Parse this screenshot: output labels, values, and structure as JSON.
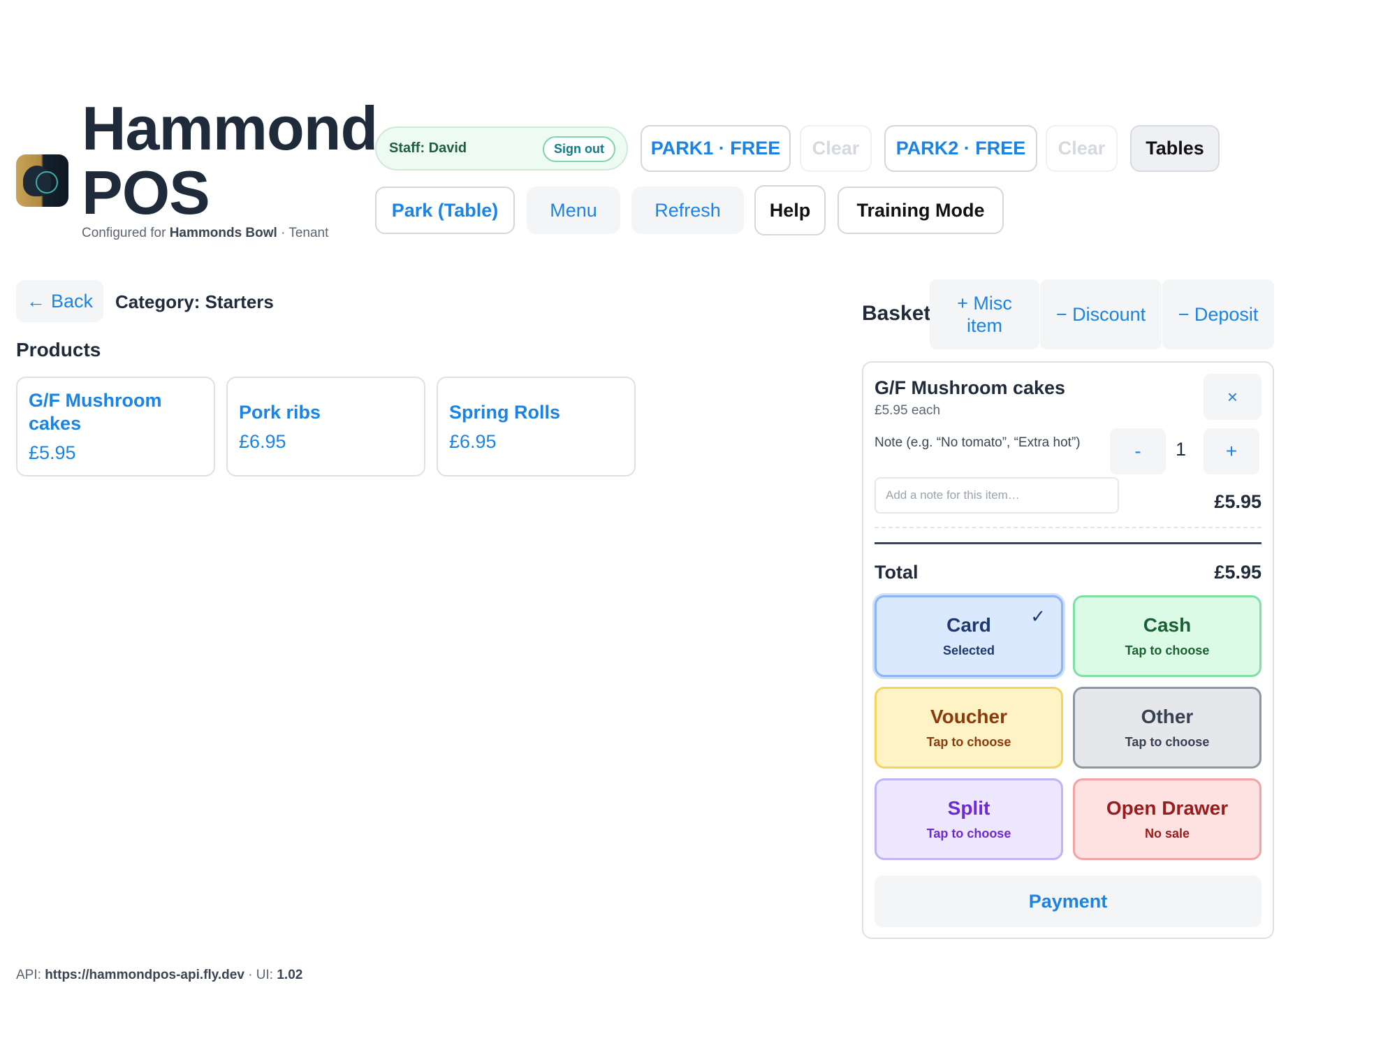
{
  "brand": {
    "title": "Hammond POS",
    "config_prefix": "Configured for",
    "tenant_name": "Hammonds Bowl",
    "config_suffix": "· Tenant"
  },
  "header": {
    "staff_label": "Staff: David",
    "sign_out": "Sign out",
    "park1": "PARK1 · FREE",
    "park1_clear": "Clear",
    "park2": "PARK2 · FREE",
    "park2_clear": "Clear",
    "tables": "Tables",
    "park_table": "Park (Table)",
    "menu": "Menu",
    "refresh": "Refresh",
    "help": "Help",
    "training": "Training Mode"
  },
  "category": {
    "back_arrow": "←",
    "back": "Back",
    "title": "Category: Starters",
    "products_heading": "Products"
  },
  "products": [
    {
      "name": "G/F Mushroom cakes",
      "price": "£5.95"
    },
    {
      "name": "Pork ribs",
      "price": "£6.95"
    },
    {
      "name": "Spring Rolls",
      "price": "£6.95"
    }
  ],
  "basket": {
    "heading": "Basket",
    "misc_item": "+ Misc item",
    "discount": "− Discount",
    "deposit": "− Deposit",
    "item": {
      "name": "G/F Mushroom cakes",
      "unit_price": "£5.95 each",
      "remove": "×",
      "note_label": "Note (e.g. “No tomato”, “Extra hot”)",
      "note_placeholder": "Add a note for this item…",
      "note_value": "",
      "minus": "-",
      "qty": "1",
      "plus": "+",
      "line_total": "£5.95"
    },
    "total_label": "Total",
    "total_value": "£5.95",
    "payment_button": "Payment"
  },
  "payment_methods": {
    "card": {
      "title": "Card",
      "sub": "Selected",
      "check": "✓"
    },
    "cash": {
      "title": "Cash",
      "sub": "Tap to choose"
    },
    "voucher": {
      "title": "Voucher",
      "sub": "Tap to choose"
    },
    "other": {
      "title": "Other",
      "sub": "Tap to choose"
    },
    "split": {
      "title": "Split",
      "sub": "Tap to choose"
    },
    "drawer": {
      "title": "Open Drawer",
      "sub": "No sale"
    }
  },
  "footer": {
    "api_prefix": "API:",
    "api_url": "https://hammondpos-api.fly.dev",
    "ui_prefix": "· UI:",
    "ui_version": "1.02"
  },
  "colors": {
    "accent": "#1a84e6",
    "text": "#1f2a3a",
    "card_bg": "#dbe9ff",
    "cash_bg": "#dcfbe6",
    "voucher_bg": "#fef3c4",
    "other_bg": "#e5e7eb",
    "split_bg": "#ede8ff",
    "drawer_bg": "#fee2e2"
  }
}
